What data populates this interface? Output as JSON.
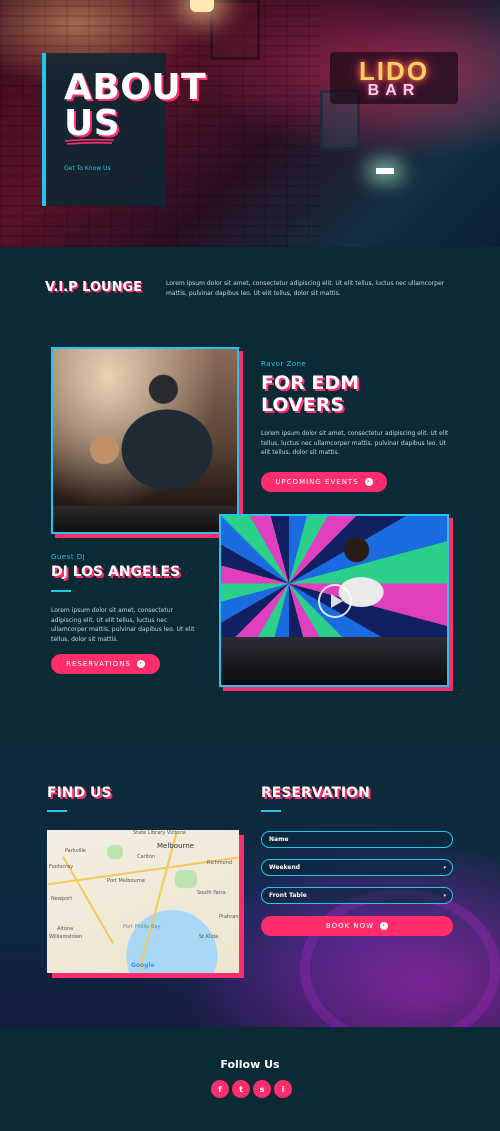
{
  "hero": {
    "title": "ABOUT US",
    "subtitle": "Get To Know Us",
    "sign_line1": "LIDO",
    "sign_line2": "BAR"
  },
  "vip": {
    "title": "V.I.P LOUNGE",
    "text": "Lorem ipsum dolor sit amet, consectetur adipiscing elit. Ut elit tellus, luctus nec ullamcorper mattis, pulvinar dapibus leo. Ut elit tellus, dolor sit mattis."
  },
  "edm": {
    "kicker": "Ravor Zone",
    "title": "FOR EDM LOVERS",
    "text": "Lorem ipsum dolor sit amet, consectetur adipiscing elit. Ut elit tellus, luctus nec ullamcorper mattis, pulvinar dapibus leo. Ut elit tellus, dolor sit mattis.",
    "button": "UPCOMING EVENTS"
  },
  "dj": {
    "kicker": "Guest DJ",
    "title": "DJ LOS ANGELES",
    "text": "Lorem ipsum dolor sit amet, consectetur adipiscing elit. Ut elit tellus, luctus nec ullamcorper mattis, pulvinar dapibus leo. Ut elit tellus, dolor sit mattis.",
    "button": "RESERVATIONS"
  },
  "find_us": {
    "title": "FIND US",
    "map_labels": [
      "State Library Victoria",
      "Melbourne",
      "Parkville",
      "Carlton",
      "Footscray",
      "Richmond",
      "Port Melbourne",
      "South Yarra",
      "Newport",
      "Altona",
      "Williamstown",
      "St Kilda",
      "Prahran",
      "Port Phillip Bay"
    ],
    "map_brand": "Google"
  },
  "reservation": {
    "title": "RESERVATION",
    "name_placeholder": "Name",
    "day_value": "Weekend",
    "table_value": "Front Table",
    "button": "BOOK NOW"
  },
  "footer": {
    "title": "Follow Us",
    "socials": [
      "f",
      "t",
      "s",
      "i"
    ]
  },
  "colors": {
    "accent": "#ff2d6b",
    "cyan": "#25c4e8",
    "bg": "#0a2a35"
  }
}
